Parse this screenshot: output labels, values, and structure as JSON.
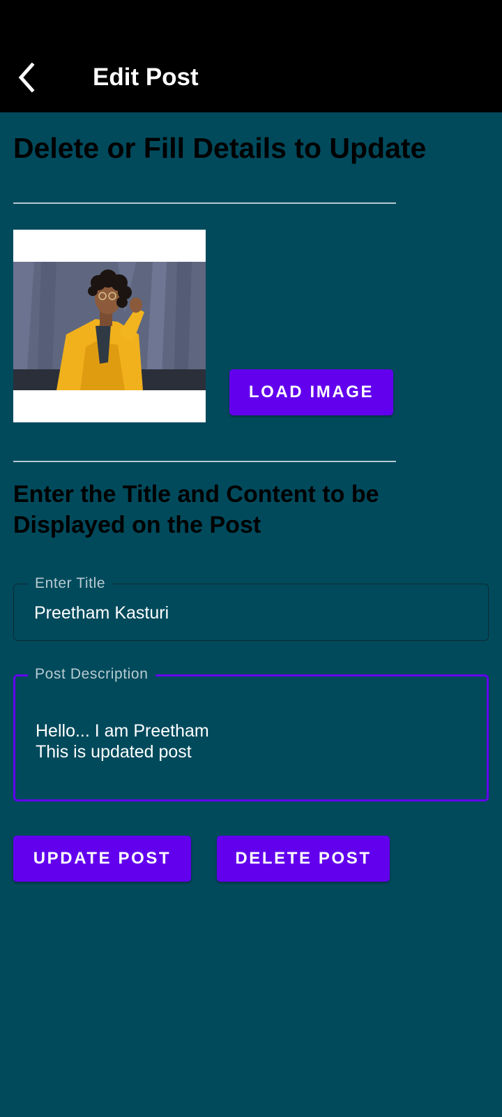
{
  "appbar": {
    "title": "Edit Post",
    "back_icon": "arrow-back-icon"
  },
  "main": {
    "heading": "Delete or Fill Details to Update",
    "image_section": {
      "load_button_label": "LOAD IMAGE"
    },
    "content_heading": "Enter the Title and Content to be Displayed on the Post",
    "title_field": {
      "label": "Enter Title",
      "value": "Preetham Kasturi"
    },
    "description_field": {
      "label": "Post Description",
      "value": "Hello... I am Preetham\nThis is updated post"
    },
    "actions": {
      "update_label": "UPDATE POST",
      "delete_label": "DELETE POST"
    }
  },
  "colors": {
    "background": "#004a5c",
    "appbar": "#000000",
    "accent": "#6200ee",
    "divider": "#b7c9cf"
  }
}
